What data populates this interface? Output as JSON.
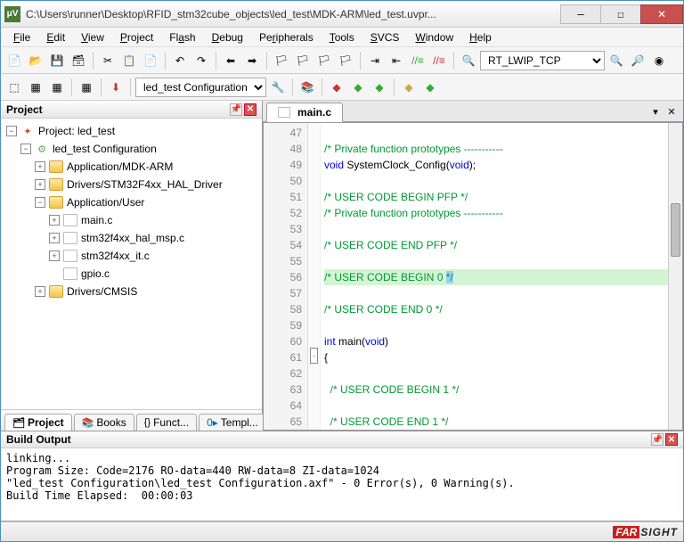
{
  "titlebar": {
    "icon": "μV",
    "text": "C:\\Users\\runner\\Desktop\\RFID_stm32cube_objects\\led_test\\MDK-ARM\\led_test.uvpr..."
  },
  "menu": [
    "File",
    "Edit",
    "View",
    "Project",
    "Flash",
    "Debug",
    "Peripherals",
    "Tools",
    "SVCS",
    "Window",
    "Help"
  ],
  "toolbar2": {
    "config_label": "led_test Configuration"
  },
  "target_select": "RT_LWIP_TCP",
  "project_panel": {
    "title": "Project",
    "tree": {
      "root": "Project: led_test",
      "cfg": "led_test Configuration",
      "g1": "Application/MDK-ARM",
      "g2": "Drivers/STM32F4xx_HAL_Driver",
      "g3": "Application/User",
      "f1": "main.c",
      "f2": "stm32f4xx_hal_msp.c",
      "f3": "stm32f4xx_it.c",
      "f4": "gpio.c",
      "g4": "Drivers/CMSIS"
    },
    "tabs": [
      "Project",
      "Books",
      "Funct...",
      "Templ..."
    ]
  },
  "editor": {
    "tab": "main.c",
    "lines": [
      {
        "n": 47,
        "t": ""
      },
      {
        "n": 48,
        "t": "/* Private function prototypes -----------",
        "cls": "cm"
      },
      {
        "n": 49,
        "t": "void SystemClock_Config(void);",
        "kind": "decl"
      },
      {
        "n": 50,
        "t": ""
      },
      {
        "n": 51,
        "t": "/* USER CODE BEGIN PFP */",
        "cls": "cm"
      },
      {
        "n": 52,
        "t": "/* Private function prototypes -----------",
        "cls": "cm"
      },
      {
        "n": 53,
        "t": ""
      },
      {
        "n": 54,
        "t": "/* USER CODE END PFP */",
        "cls": "cm"
      },
      {
        "n": 55,
        "t": ""
      },
      {
        "n": 56,
        "t": "/* USER CODE BEGIN 0 */",
        "cls": "cm hl",
        "cursor": true
      },
      {
        "n": 57,
        "t": ""
      },
      {
        "n": 58,
        "t": "/* USER CODE END 0 */",
        "cls": "cm"
      },
      {
        "n": 59,
        "t": ""
      },
      {
        "n": 60,
        "t": "int main(void)",
        "kind": "decl2"
      },
      {
        "n": 61,
        "t": "{",
        "fold": "-"
      },
      {
        "n": 62,
        "t": ""
      },
      {
        "n": 63,
        "t": "  /* USER CODE BEGIN 1 */",
        "cls": "cm"
      },
      {
        "n": 64,
        "t": ""
      },
      {
        "n": 65,
        "t": "  /* USER CODE END 1 */",
        "cls": "cm"
      }
    ]
  },
  "build": {
    "title": "Build Output",
    "text": "linking...\nProgram Size: Code=2176 RO-data=440 RW-data=8 ZI-data=1024\n\"led_test Configuration\\led_test Configuration.axf\" - 0 Error(s), 0 Warning(s).\nBuild Time Elapsed:  00:00:03"
  },
  "brand": {
    "a": "FAR",
    "b": "SIGHT"
  }
}
